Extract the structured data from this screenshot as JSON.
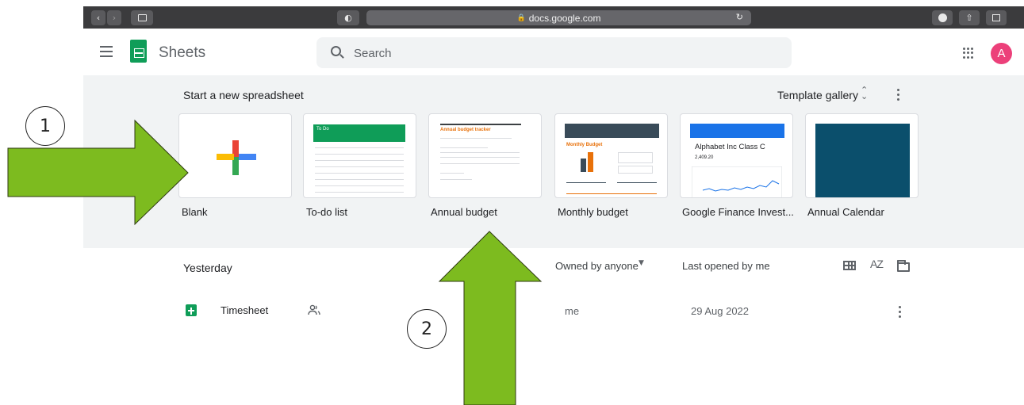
{
  "browser": {
    "url": "docs.google.com"
  },
  "header": {
    "app_name": "Sheets",
    "search_placeholder": "Search",
    "avatar_initial": "A"
  },
  "templates": {
    "section_title": "Start a new spreadsheet",
    "gallery_label": "Template gallery",
    "items": [
      {
        "label": "Blank"
      },
      {
        "label": "To-do list",
        "thumb_title": "To Do"
      },
      {
        "label": "Annual budget",
        "thumb_title": "Annual budget tracker"
      },
      {
        "label": "Monthly budget",
        "thumb_title": "Monthly Budget"
      },
      {
        "label": "Google Finance Invest...",
        "thumb_title": "Alphabet Inc Class C",
        "thumb_value": "2,409.20"
      },
      {
        "label": "Annual Calendar"
      }
    ]
  },
  "recent": {
    "section_title": "Yesterday",
    "owner_filter": "Owned by anyone",
    "sort_label": "Last opened by me",
    "sort_icon": "AZ",
    "files": [
      {
        "name": "Timesheet",
        "owner": "me",
        "date": "29 Aug 2022"
      }
    ]
  },
  "annotations": {
    "marker_1": "1",
    "marker_2": "2",
    "arrow_color": "#7dbb1f"
  }
}
